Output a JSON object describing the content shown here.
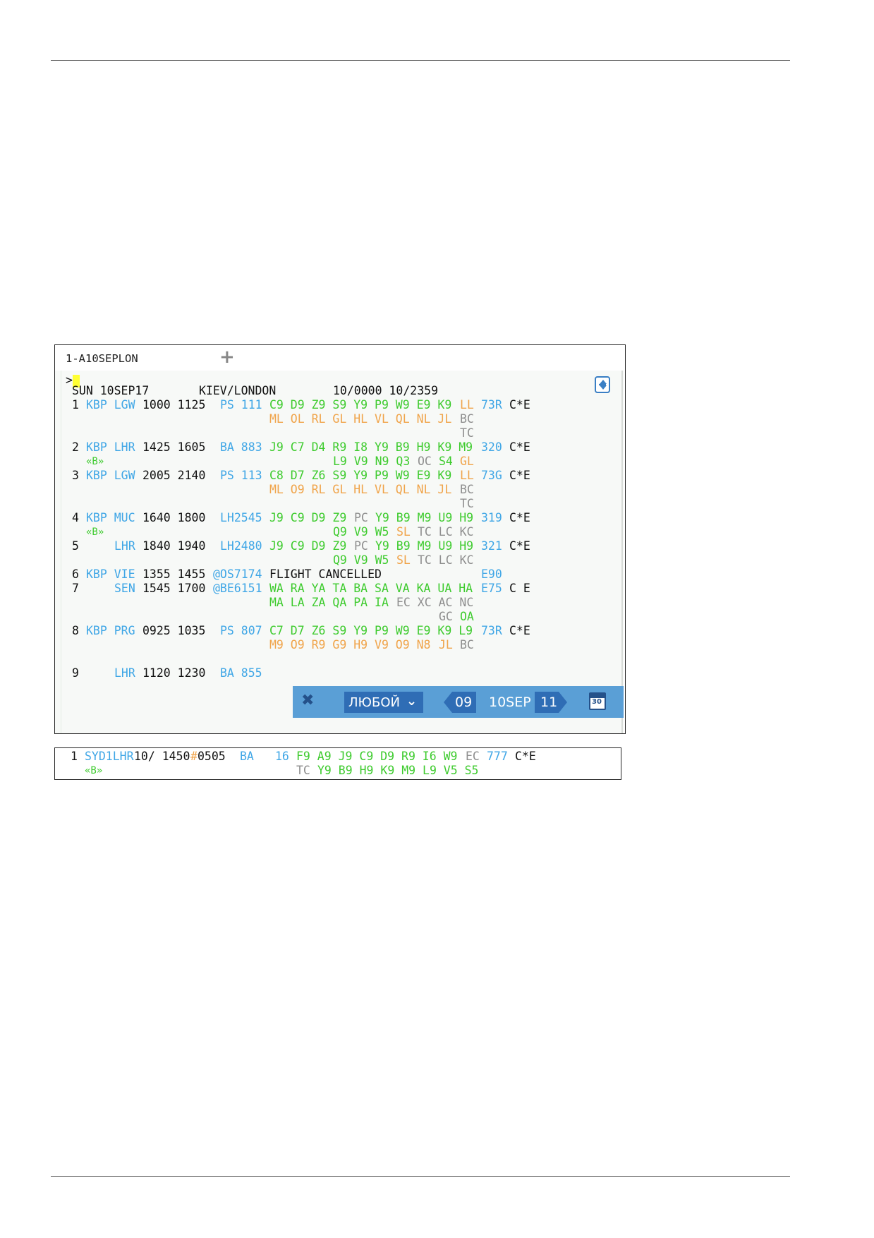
{
  "terminal": {
    "tab_label": "1-A10SEPLON",
    "add_tab_icon": "plus-icon",
    "prompt": ">",
    "scroll_icon": "scroll-toggle-icon",
    "lines": [
      {
        "y": 0,
        "spans": [
          {
            "t": "SUN 10SEP17",
            "c": "k",
            "x": 0
          },
          {
            "t": "KIEV/LONDON",
            "c": "k",
            "x": 18
          },
          {
            "t": "10/0000 10/2359",
            "c": "k",
            "x": 37
          }
        ]
      },
      {
        "y": 1,
        "spans": [
          {
            "t": "1",
            "c": "k",
            "x": 0
          },
          {
            "t": "KBP LGW",
            "c": "b",
            "x": 2
          },
          {
            "t": "1000 1125",
            "c": "k",
            "x": 10
          },
          {
            "t": "PS 111",
            "c": "b",
            "x": 21
          },
          {
            "t": "C9 D9 Z9 S9 Y9 P9 W9 E9 K9",
            "c": "g",
            "x": 28
          },
          {
            "t": "LL",
            "c": "o",
            "x": 55
          },
          {
            "t": "73R",
            "c": "b",
            "x": 58
          },
          {
            "t": "C*E",
            "c": "k",
            "x": 62
          }
        ]
      },
      {
        "y": 2,
        "spans": [
          {
            "t": "ML OL RL GL HL VL QL NL JL",
            "c": "o",
            "x": 28
          },
          {
            "t": "BC",
            "c": "y",
            "x": 55
          }
        ]
      },
      {
        "y": 3,
        "spans": [
          {
            "t": "TC",
            "c": "y",
            "x": 55
          }
        ]
      },
      {
        "y": 4,
        "spans": [
          {
            "t": "2",
            "c": "k",
            "x": 0
          },
          {
            "t": "KBP LHR",
            "c": "b",
            "x": 2
          },
          {
            "t": "1425 1605",
            "c": "k",
            "x": 10
          },
          {
            "t": "BA 883",
            "c": "b",
            "x": 21
          },
          {
            "t": "J9 C7 D4 R9 I8 Y9 B9 H9 K9 M9",
            "c": "g",
            "x": 28
          },
          {
            "t": "320",
            "c": "b",
            "x": 58
          },
          {
            "t": "C*E",
            "c": "k",
            "x": 62
          }
        ]
      },
      {
        "y": 5,
        "spans": [
          {
            "t": "«B»",
            "c": "g sm",
            "x": 2
          },
          {
            "t": "L9 V9 N9 Q3",
            "c": "g",
            "x": 37
          },
          {
            "t": "OC",
            "c": "y",
            "x": 49
          },
          {
            "t": "S4",
            "c": "g",
            "x": 52
          },
          {
            "t": "GL",
            "c": "o",
            "x": 55
          }
        ]
      },
      {
        "y": 6,
        "spans": [
          {
            "t": "3",
            "c": "k",
            "x": 0
          },
          {
            "t": "KBP LGW",
            "c": "b",
            "x": 2
          },
          {
            "t": "2005 2140",
            "c": "k",
            "x": 10
          },
          {
            "t": "PS 113",
            "c": "b",
            "x": 21
          },
          {
            "t": "C8 D7 Z6 S9 Y9 P9 W9 E9 K9",
            "c": "g",
            "x": 28
          },
          {
            "t": "LL",
            "c": "o",
            "x": 55
          },
          {
            "t": "73G",
            "c": "b",
            "x": 58
          },
          {
            "t": "C*E",
            "c": "k",
            "x": 62
          }
        ]
      },
      {
        "y": 7,
        "spans": [
          {
            "t": "ML O9 RL GL HL VL QL NL JL",
            "c": "o",
            "x": 28
          },
          {
            "t": "BC",
            "c": "y",
            "x": 55
          }
        ]
      },
      {
        "y": 8,
        "spans": [
          {
            "t": "TC",
            "c": "y",
            "x": 55
          }
        ]
      },
      {
        "y": 9,
        "spans": [
          {
            "t": "4",
            "c": "k",
            "x": 0
          },
          {
            "t": "KBP MUC",
            "c": "b",
            "x": 2
          },
          {
            "t": "1640 1800",
            "c": "k",
            "x": 10
          },
          {
            "t": "LH2545",
            "c": "b",
            "x": 21
          },
          {
            "t": "J9 C9 D9 Z9",
            "c": "g",
            "x": 28
          },
          {
            "t": "PC",
            "c": "y",
            "x": 40
          },
          {
            "t": "Y9 B9 M9 U9 H9",
            "c": "g",
            "x": 43
          },
          {
            "t": "319",
            "c": "b",
            "x": 58
          },
          {
            "t": "C*E",
            "c": "k",
            "x": 62
          }
        ]
      },
      {
        "y": 10,
        "spans": [
          {
            "t": "«B»",
            "c": "g sm",
            "x": 2
          },
          {
            "t": "Q9 V9 W5",
            "c": "g",
            "x": 37
          },
          {
            "t": "SL",
            "c": "o",
            "x": 46
          },
          {
            "t": "TC LC KC",
            "c": "y",
            "x": 49
          }
        ]
      },
      {
        "y": 11,
        "spans": [
          {
            "t": "5",
            "c": "k",
            "x": 0
          },
          {
            "t": "LHR",
            "c": "b",
            "x": 6
          },
          {
            "t": "1840 1940",
            "c": "k",
            "x": 10
          },
          {
            "t": "LH2480",
            "c": "b",
            "x": 21
          },
          {
            "t": "J9 C9 D9 Z9",
            "c": "g",
            "x": 28
          },
          {
            "t": "PC",
            "c": "y",
            "x": 40
          },
          {
            "t": "Y9 B9 M9 U9 H9",
            "c": "g",
            "x": 43
          },
          {
            "t": "321",
            "c": "b",
            "x": 58
          },
          {
            "t": "C*E",
            "c": "k",
            "x": 62
          }
        ]
      },
      {
        "y": 12,
        "spans": [
          {
            "t": "Q9 V9 W5",
            "c": "g",
            "x": 37
          },
          {
            "t": "SL",
            "c": "o",
            "x": 46
          },
          {
            "t": "TC LC KC",
            "c": "y",
            "x": 49
          }
        ]
      },
      {
        "y": 13,
        "spans": [
          {
            "t": "6",
            "c": "k",
            "x": 0
          },
          {
            "t": "KBP VIE",
            "c": "b",
            "x": 2
          },
          {
            "t": "1355 1455",
            "c": "k",
            "x": 10
          },
          {
            "t": "@OS7174",
            "c": "b",
            "x": 20
          },
          {
            "t": "FLIGHT CANCELLED",
            "c": "k",
            "x": 28
          },
          {
            "t": "E90",
            "c": "b",
            "x": 58
          }
        ]
      },
      {
        "y": 14,
        "spans": [
          {
            "t": "7",
            "c": "k",
            "x": 0
          },
          {
            "t": "SEN",
            "c": "b",
            "x": 6
          },
          {
            "t": "1545 1700",
            "c": "k",
            "x": 10
          },
          {
            "t": "@BE6151",
            "c": "b",
            "x": 20
          },
          {
            "t": "WA RA YA TA BA SA VA KA UA HA",
            "c": "g",
            "x": 28
          },
          {
            "t": "E75",
            "c": "b",
            "x": 58
          },
          {
            "t": "C E",
            "c": "k",
            "x": 62
          }
        ]
      },
      {
        "y": 15,
        "spans": [
          {
            "t": "MA LA ZA QA PA IA",
            "c": "g",
            "x": 28
          },
          {
            "t": "EC XC AC NC",
            "c": "y",
            "x": 46
          }
        ]
      },
      {
        "y": 16,
        "spans": [
          {
            "t": "GC",
            "c": "y",
            "x": 52
          },
          {
            "t": "OA",
            "c": "g",
            "x": 55
          }
        ]
      },
      {
        "y": 17,
        "spans": [
          {
            "t": "8",
            "c": "k",
            "x": 0
          },
          {
            "t": "KBP PRG",
            "c": "b",
            "x": 2
          },
          {
            "t": "0925 1035",
            "c": "k",
            "x": 10
          },
          {
            "t": "PS 807",
            "c": "b",
            "x": 21
          },
          {
            "t": "C7 D7 Z6 S9 Y9 P9 W9 E9 K9 L9",
            "c": "g",
            "x": 28
          },
          {
            "t": "73R",
            "c": "b",
            "x": 58
          },
          {
            "t": "C*E",
            "c": "k",
            "x": 62
          }
        ]
      },
      {
        "y": 18,
        "spans": [
          {
            "t": "M9 O9 R9 G9 H9 V9 O9 N8",
            "c": "o",
            "x": 28
          },
          {
            "t": "JL",
            "c": "o",
            "x": 52
          },
          {
            "t": "BC",
            "c": "y",
            "x": 55
          }
        ]
      },
      {
        "y": 20,
        "spans": [
          {
            "t": "9",
            "c": "k",
            "x": 0
          },
          {
            "t": "LHR",
            "c": "b",
            "x": 6
          },
          {
            "t": "1120 1230",
            "c": "k",
            "x": 10
          },
          {
            "t": "BA 855",
            "c": "b",
            "x": 21
          }
        ]
      }
    ],
    "toolbar": {
      "close_icon": "close-icon",
      "filter_value": "ЛЮБОЙ",
      "prev_day": "09",
      "current_date": "10SEP",
      "next_day": "11",
      "calendar_icon": "calendar-icon",
      "calendar_number": "30"
    }
  },
  "second_terminal": {
    "lines": [
      {
        "y": 0,
        "spans": [
          {
            "t": "1",
            "c": "k",
            "x": 0
          },
          {
            "t": "SYD1LHR",
            "c": "b",
            "x": 2
          },
          {
            "t": "10/ 1450",
            "c": "k",
            "x": 9
          },
          {
            "t": "#",
            "c": "o",
            "x": 17
          },
          {
            "t": "0505",
            "c": "k",
            "x": 18
          },
          {
            "t": "BA",
            "c": "b",
            "x": 24
          },
          {
            "t": "16",
            "c": "b",
            "x": 29
          },
          {
            "t": "F9 A9 J9 C9 D9 R9 I6 W9",
            "c": "g",
            "x": 32
          },
          {
            "t": "EC",
            "c": "y",
            "x": 56
          },
          {
            "t": "777",
            "c": "b",
            "x": 59
          },
          {
            "t": "C*E",
            "c": "k",
            "x": 63
          }
        ]
      },
      {
        "y": 1,
        "spans": [
          {
            "t": "«B»",
            "c": "g sm",
            "x": 2
          },
          {
            "t": "TC",
            "c": "y",
            "x": 32
          },
          {
            "t": "Y9 B9 H9 K9 M9 L9 V5 S5",
            "c": "g",
            "x": 35
          }
        ]
      }
    ]
  }
}
